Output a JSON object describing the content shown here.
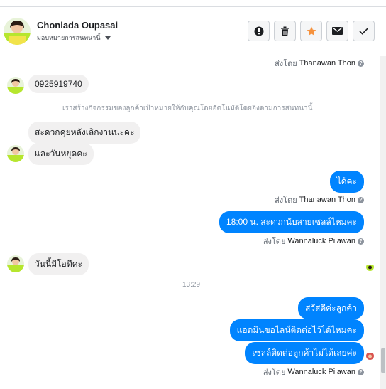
{
  "header": {
    "name": "Chonlada Oupasai",
    "assign_label": "มอบหมายการสนทนานี้",
    "actions": [
      {
        "icon": "alert-icon"
      },
      {
        "icon": "trash-icon"
      },
      {
        "icon": "star-icon"
      },
      {
        "icon": "mail-icon"
      },
      {
        "icon": "check-icon"
      }
    ]
  },
  "colors": {
    "accent_blue": "#0084ff",
    "star_orange": "#f5923e"
  },
  "chat": {
    "sent_by_1": {
      "prefix": "ส่งโดย",
      "name": "Thanawan Thon",
      "help": "?"
    },
    "phone_message": "0925919740",
    "system_note": "เราสร้างกิจกรรมของลูกค้าเป้าหมายให้กับคุณโดยอัตโนมัติโดยอิงตามการสนทนานี้",
    "in_msg_1": "สะดวกคุยหลังเลิกงานนะคะ",
    "in_msg_2": "และวันหยุดคะ",
    "out_msg_1": "ได้คะ",
    "sent_by_2": {
      "prefix": "ส่งโดย",
      "name": "Thanawan Thon",
      "help": "?"
    },
    "out_msg_2": "18:00 น. สะดวกนับสายเซลล์ไหมคะ",
    "sent_by_3": {
      "prefix": "ส่งโดย",
      "name": "Wannaluck Pilawan",
      "help": "?"
    },
    "in_msg_3": "วันนี้มีโอทีคะ",
    "timestamp": "13:29",
    "out_msg_3": "สวัสดีค่ะลูกค้า",
    "out_msg_4": "แอดมินขอไลน์ติดต่อไว้ได้ไหมคะ",
    "out_msg_5": "เซลล์ติดต่อลูกค้าไม่ได้เลยค่ะ",
    "sent_by_4": {
      "prefix": "ส่งโดย",
      "name": "Wannaluck Pilawan",
      "help": "?"
    }
  }
}
